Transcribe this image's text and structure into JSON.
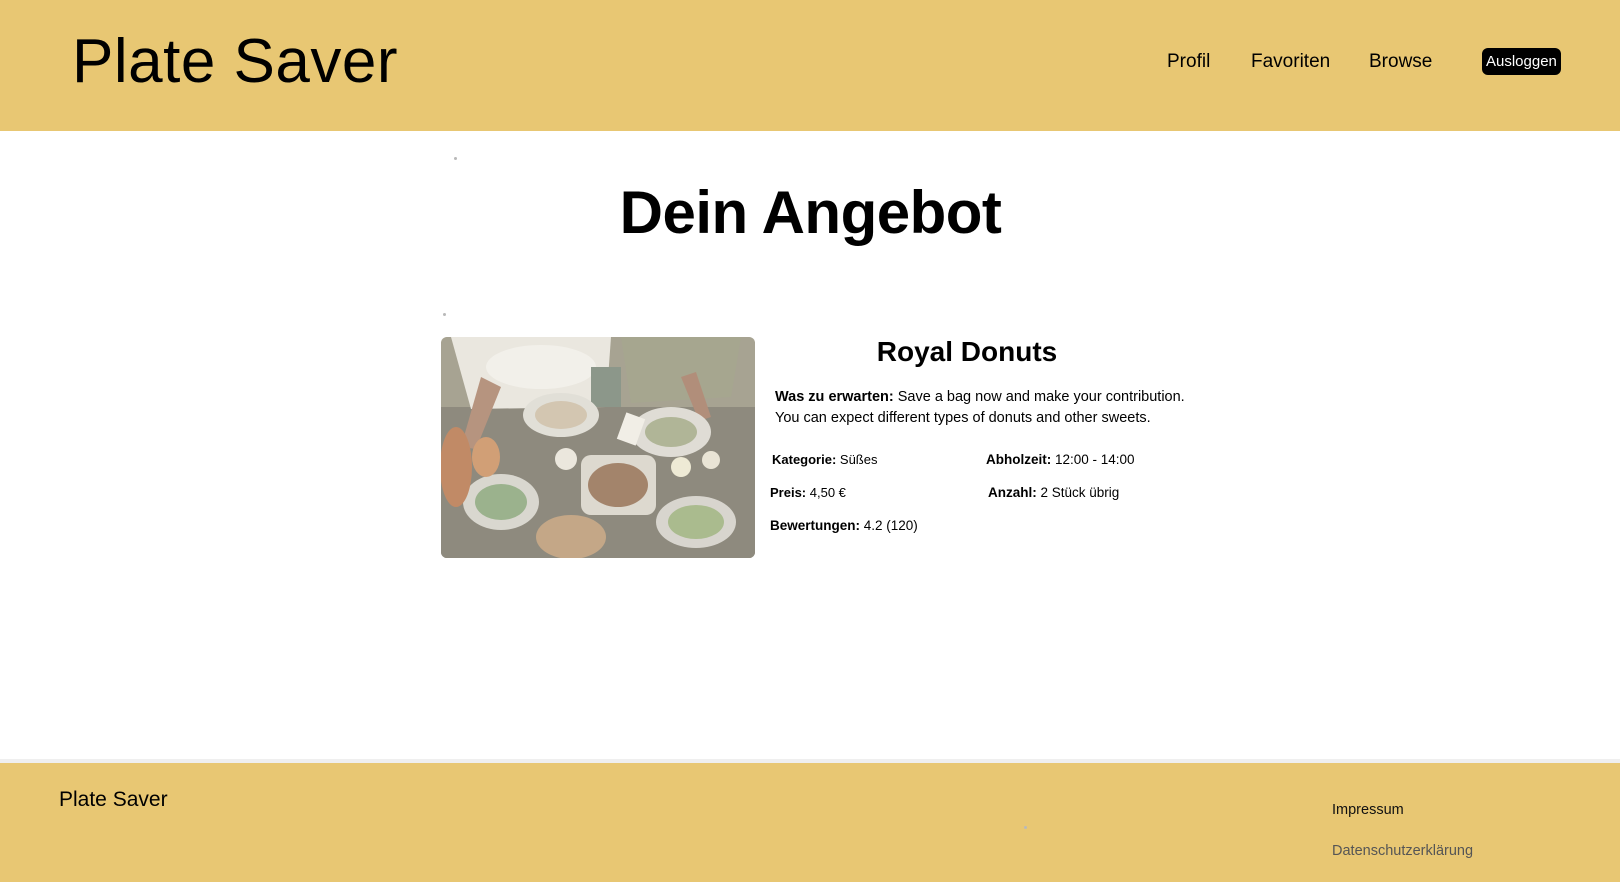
{
  "header": {
    "brand": "Plate Saver",
    "nav": [
      "Profil",
      "Favoriten",
      "Browse"
    ],
    "logout_label": "Ausloggen"
  },
  "main": {
    "title": "Dein Angebot",
    "offer": {
      "name": "Royal Donuts",
      "description_label": "Was zu erwarten:",
      "description": " Save a bag now and make your contribution. You can expect different types of donuts and other sweets.",
      "fields": {
        "kategorie_label": "Kategorie:",
        "kategorie": " Süßes",
        "abholzeit_label": "Abholzeit:",
        "abholzeit": " 12:00 - 14:00",
        "preis_label": "Preis:",
        "preis": " 4,50 €",
        "anzahl_label": "Anzahl:",
        "anzahl": " 2 Stück übrig",
        "bewertungen_label": "Bewertungen:",
        "bewertungen": " 4.2 (120)"
      }
    }
  },
  "footer": {
    "brand": "Plate Saver",
    "links": [
      "Impressum",
      "Datenschutzerklärung"
    ]
  },
  "colors": {
    "brand_yellow": "#e8c773",
    "button_black": "#000000"
  }
}
